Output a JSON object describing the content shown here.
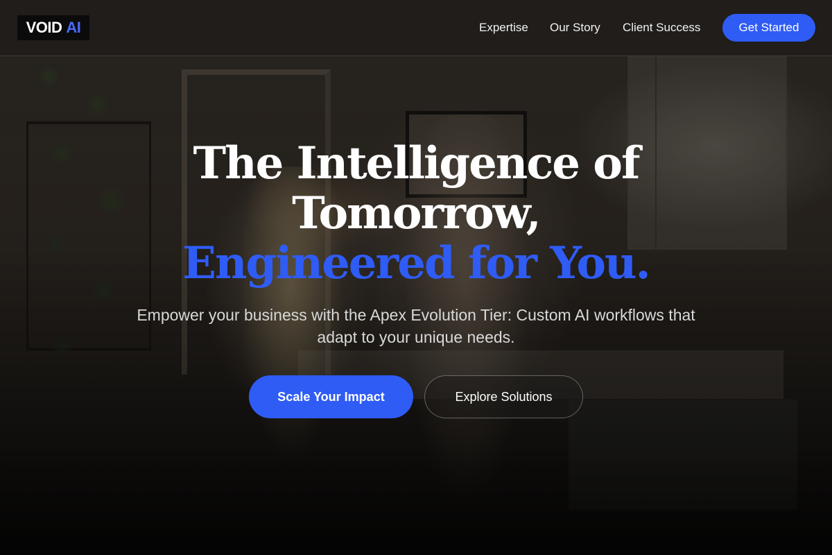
{
  "header": {
    "logo": {
      "primary": "VOID",
      "accent": "AI"
    },
    "nav": [
      {
        "label": "Expertise"
      },
      {
        "label": "Our Story"
      },
      {
        "label": "Client Success"
      }
    ],
    "cta_label": "Get Started"
  },
  "hero": {
    "title_line_1": "The Intelligence of",
    "title_line_2": "Tomorrow,",
    "title_line_3": "Engineered for You.",
    "subtitle": "Empower your business with the Apex Evolution Tier: Custom AI workflows that adapt to your unique needs.",
    "primary_button": "Scale Your Impact",
    "secondary_button": "Explore Solutions"
  },
  "colors": {
    "accent": "#2f5cf5",
    "logo_accent": "#4a6cf7",
    "text_primary": "#ffffff",
    "text_secondary": "#d9d9d9",
    "nav_background": "#1e1c19"
  }
}
